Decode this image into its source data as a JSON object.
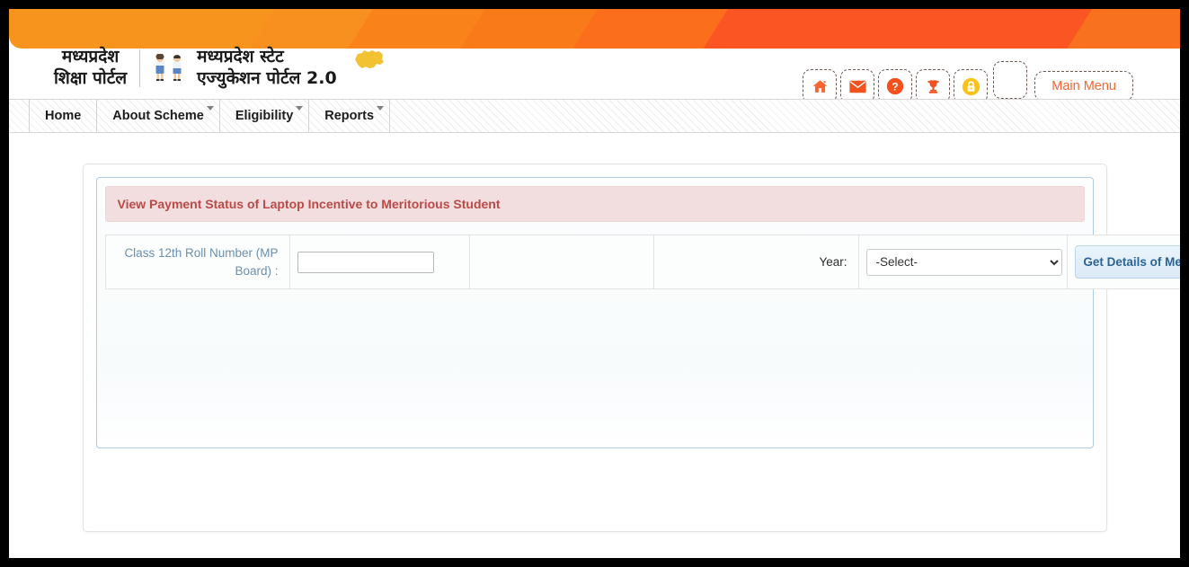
{
  "branding": {
    "logo_left_text": "मध्यप्रदेश\nशिक्षा पोर्टल",
    "logo_right_text": "मध्यप्रदेश स्टेट\nएज्युकेशन पोर्टल 2.0",
    "map_icon": "madhya-pradesh-map-icon",
    "students_icon": "two-students-icon"
  },
  "header_icons": [
    {
      "name": "home-icon",
      "glyph": "⌂"
    },
    {
      "name": "envelope-icon",
      "glyph": "✉"
    },
    {
      "name": "help-icon",
      "glyph": "?"
    },
    {
      "name": "trophy-icon",
      "glyph": "Ἴ6"
    },
    {
      "name": "lock-icon",
      "glyph": "ὑ2"
    },
    {
      "name": "blank-icon",
      "glyph": ""
    }
  ],
  "header": {
    "main_menu_label": "Main Menu"
  },
  "nav": {
    "items": [
      {
        "label": "Home",
        "caret": false
      },
      {
        "label": "About Scheme",
        "caret": true
      },
      {
        "label": "Eligibility",
        "caret": true
      },
      {
        "label": "Reports",
        "caret": true
      }
    ]
  },
  "panel": {
    "title": "View Payment Status of Laptop Incentive to Meritorious Student"
  },
  "form": {
    "roll_label": "Class 12th Roll Number (MP Board) :",
    "roll_value": "",
    "roll_placeholder": "",
    "year_label": "Year:",
    "year_selected": "-Select-",
    "year_options": [
      "-Select-"
    ],
    "submit_label": "Get Details of Meritorious Student"
  },
  "colors": {
    "banner_start": "#f7941e",
    "banner_end": "#fb5523",
    "accent_orange": "#fa6432",
    "title_bg": "#f2dede",
    "title_text": "#b94a48",
    "button_text": "#2a6496",
    "label_blue": "#6b8fae",
    "map_yellow": "#f2c233"
  }
}
